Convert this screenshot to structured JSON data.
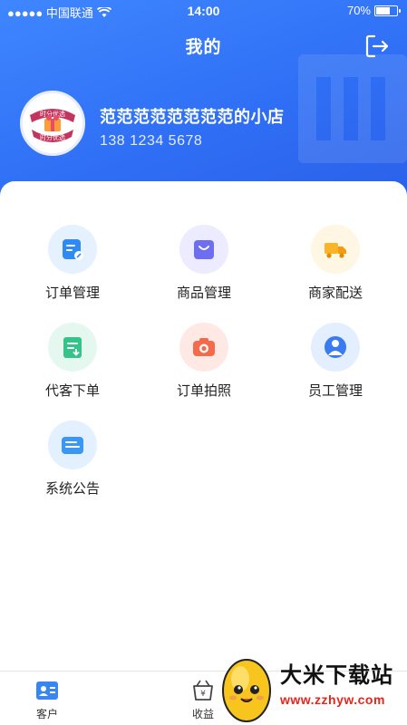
{
  "status_bar": {
    "carrier": "●●●●● 中国联通",
    "time": "14:00",
    "battery": "70%",
    "battery_level": 0.7
  },
  "header": {
    "title": "我的",
    "logout_icon": "logout-icon"
  },
  "profile": {
    "avatar_icon": "shop-logo-icon",
    "avatar_text_top": "时分优选",
    "avatar_text_bottom": "时分优选",
    "shop_name": "范范范范范范范范的小店",
    "phone": "138 1234 5678"
  },
  "menu": {
    "items": [
      {
        "label": "订单管理",
        "icon": "order-manage-icon"
      },
      {
        "label": "商品管理",
        "icon": "product-manage-icon"
      },
      {
        "label": "商家配送",
        "icon": "delivery-truck-icon"
      },
      {
        "label": "代客下单",
        "icon": "proxy-order-icon"
      },
      {
        "label": "订单拍照",
        "icon": "camera-icon"
      },
      {
        "label": "员工管理",
        "icon": "staff-icon"
      },
      {
        "label": "系统公告",
        "icon": "announcement-icon"
      }
    ]
  },
  "tabbar": {
    "items": [
      {
        "label": "客户",
        "icon": "customer-card-icon"
      },
      {
        "label": "收益",
        "icon": "income-basket-icon"
      }
    ]
  },
  "watermark": {
    "title": "大米下载站",
    "url": "www.zzhyw.com"
  }
}
